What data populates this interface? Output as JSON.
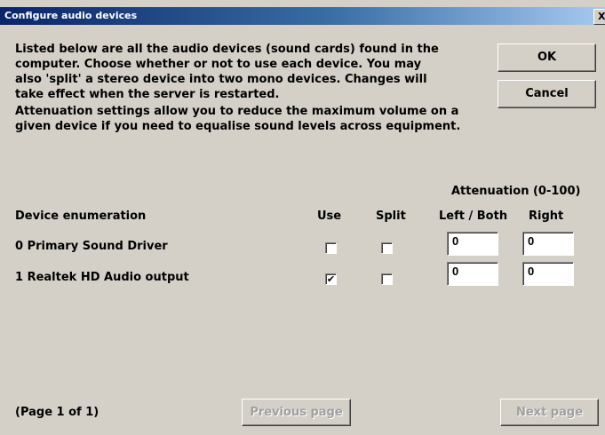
{
  "window": {
    "title": "Configure audio devices",
    "close_label": "X"
  },
  "intro": {
    "lines": [
      "Listed below are all the audio devices (sound cards) found in the",
      "computer. Choose whether or not to use each device. You may",
      "also 'split' a stereo device into two mono devices. Changes will",
      "take effect when the server is restarted."
    ]
  },
  "attenuation_note": {
    "lines": [
      "Attenuation settings allow you to reduce the maximum volume on a",
      "given device if you need to equalise sound levels across equipment."
    ]
  },
  "buttons": {
    "ok": "OK",
    "cancel": "Cancel",
    "previous_page": "Previous page",
    "next_page": "Next page"
  },
  "table": {
    "attenuation_header": "Attenuation (0-100)",
    "columns": {
      "device": "Device enumeration",
      "use": "Use",
      "split": "Split",
      "left_both": "Left / Both",
      "right": "Right"
    },
    "rows": [
      {
        "name": "0 Primary Sound Driver",
        "use": false,
        "split": false,
        "left": "0",
        "right": "0"
      },
      {
        "name": "1 Realtek HD Audio output",
        "use": true,
        "split": false,
        "left": "0",
        "right": "0"
      }
    ]
  },
  "footer": {
    "page_indicator": "(Page 1 of 1)"
  }
}
